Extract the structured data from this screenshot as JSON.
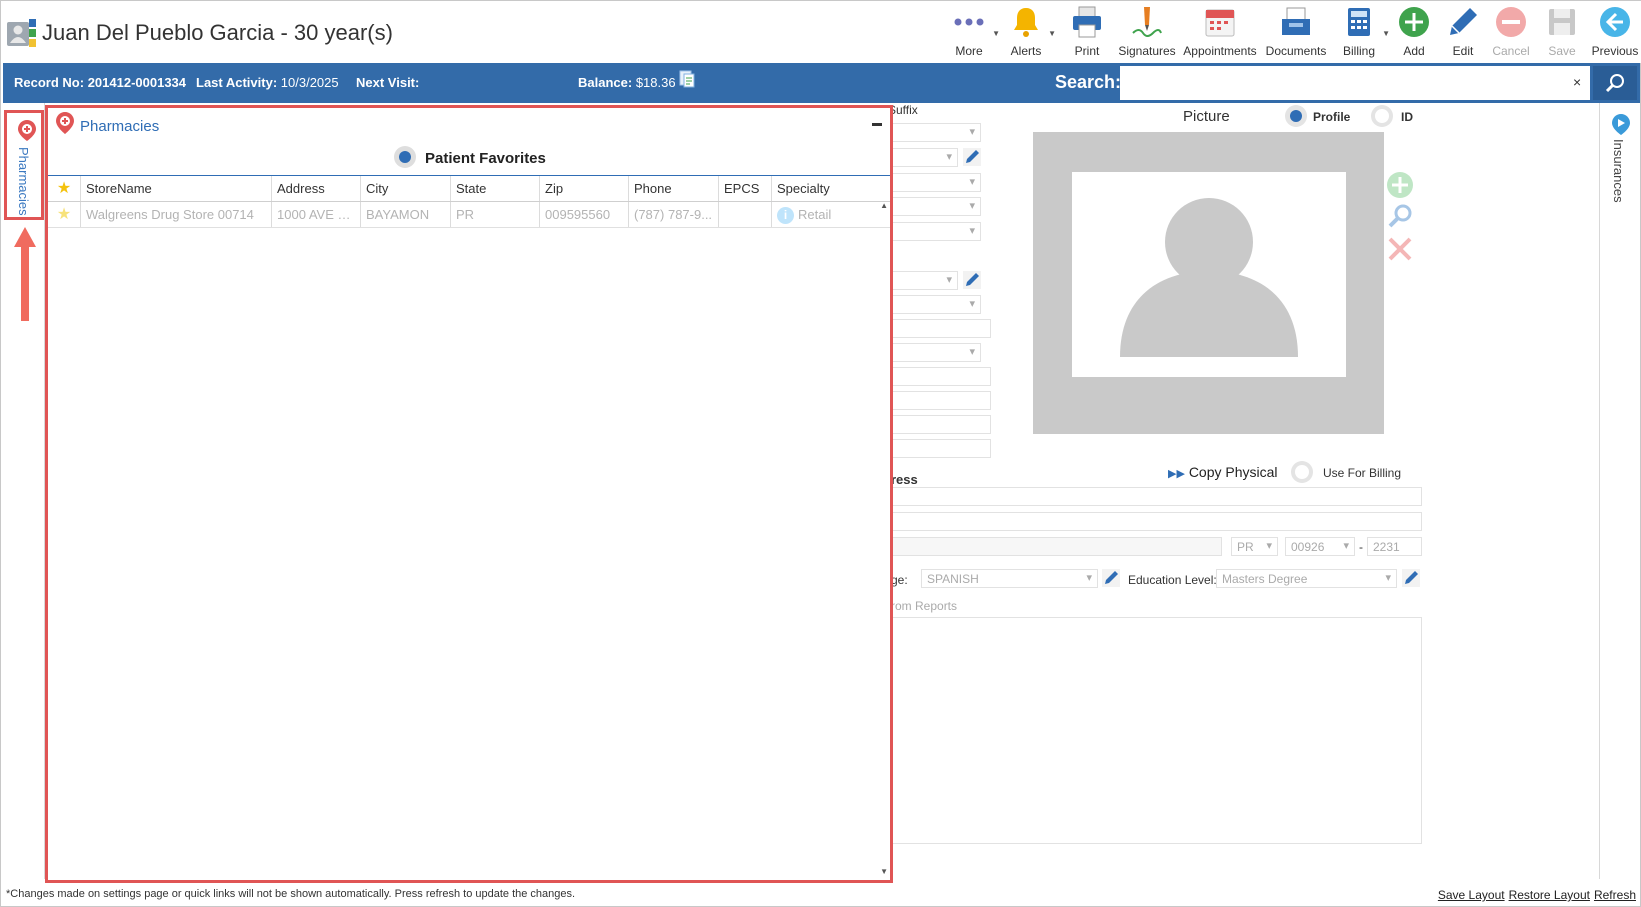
{
  "header": {
    "title": "Juan Del Pueblo Garcia - 30 year(s)"
  },
  "toolbar": {
    "more": "More",
    "alerts": "Alerts",
    "print": "Print",
    "signatures": "Signatures",
    "appointments": "Appointments",
    "documents": "Documents",
    "billing": "Billing",
    "add": "Add",
    "edit": "Edit",
    "cancel": "Cancel",
    "save": "Save",
    "previous": "Previous"
  },
  "infobar": {
    "record_label": "Record No:",
    "record_value": "201412-0001334",
    "activity_label": "Last Activity:",
    "activity_value": "10/3/2025",
    "next_visit_label": "Next Visit:",
    "balance_label": "Balance:",
    "balance_value": "$18.36",
    "search_label": "Search:",
    "search_value": "",
    "search_clear": "×"
  },
  "left_rail": {
    "tab_label": "Pharmacies"
  },
  "right_rail": {
    "tab_label": "Insurances"
  },
  "pharmacies_panel": {
    "title": "Pharmacies",
    "pin": "▬",
    "filter_label": "Patient Favorites",
    "columns": [
      "",
      "StoreName",
      "Address",
      "City",
      "State",
      "Zip",
      "Phone",
      "EPCS",
      "Specialty"
    ],
    "rows": [
      {
        "store": "Walgreens Drug Store 00714",
        "address": "1000 AVE R...",
        "city": "BAYAMON",
        "state": "PR",
        "zip": "009595560",
        "phone": "(787) 787-9...",
        "epcs": "",
        "specialty": "Retail"
      }
    ]
  },
  "background_form": {
    "suffix_label": "Suffix",
    "picture_label": "Picture",
    "profile_label": "Profile",
    "id_label": "ID",
    "address_label_fragment": "ress",
    "copy_physical_label": "Copy Physical",
    "use_for_billing_label": "Use For Billing",
    "state_value": "PR",
    "zip_value": "00926",
    "zip_ext_value": "2231",
    "language_label_fragment": "ge:",
    "language_value": "SPANISH",
    "education_label": "Education Level:",
    "education_value": "Masters Degree",
    "reports_fragment": "rom Reports"
  },
  "footer": {
    "note": "*Changes made on settings page or quick links will not be shown automatically. Press refresh to update the changes.",
    "save_layout": "Save Layout",
    "restore_layout": "Restore Layout",
    "refresh": "Refresh"
  },
  "colors": {
    "brand_blue": "#336ba9",
    "highlight_red": "#e05555",
    "link_blue": "#2f6db5"
  }
}
